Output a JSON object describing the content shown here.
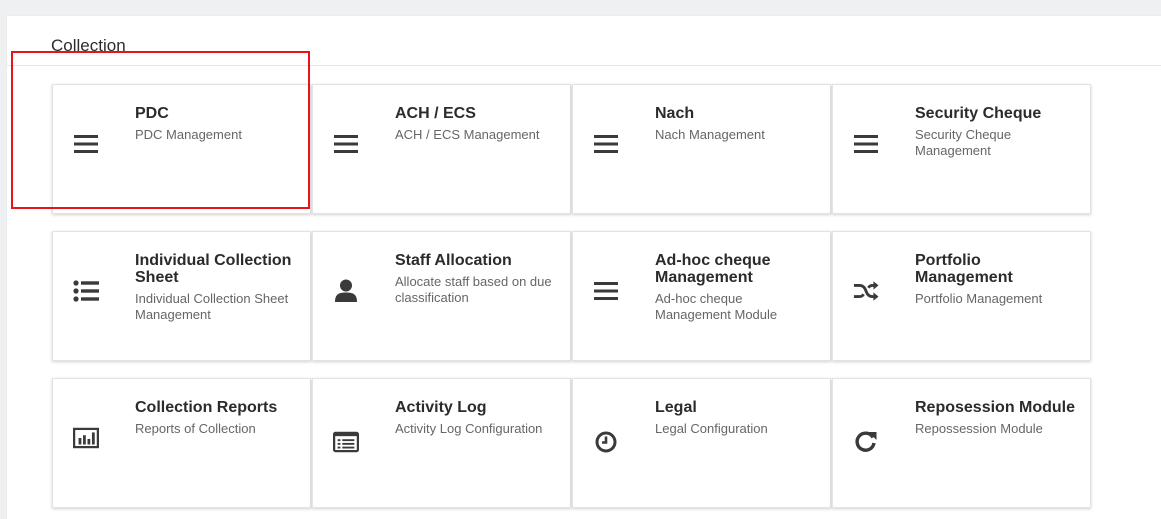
{
  "section": {
    "title": "Collection"
  },
  "colors": {
    "highlight": "#e8141c",
    "icon": "#3a3a3a"
  },
  "cards": [
    {
      "title": "PDC",
      "description": "PDC Management",
      "icon": "menu-icon"
    },
    {
      "title": "ACH / ECS",
      "description": "ACH / ECS Management",
      "icon": "menu-icon"
    },
    {
      "title": "Nach",
      "description": "Nach Management",
      "icon": "menu-icon"
    },
    {
      "title": "Security Cheque",
      "description": "Security Cheque Management",
      "icon": "menu-icon"
    },
    {
      "title": "Individual Collection Sheet",
      "description": "Individual Collection Sheet Management",
      "icon": "list-icon"
    },
    {
      "title": "Staff Allocation",
      "description": "Allocate staff based on due classification",
      "icon": "user-icon"
    },
    {
      "title": "Ad-hoc cheque Management",
      "description": "Ad-hoc cheque Management Module",
      "icon": "menu-icon"
    },
    {
      "title": "Portfolio Management",
      "description": "Portfolio Management",
      "icon": "shuffle-icon"
    },
    {
      "title": "Collection Reports",
      "description": "Reports of Collection",
      "icon": "bar-chart-icon"
    },
    {
      "title": "Activity Log",
      "description": "Activity Log Configuration",
      "icon": "list-alt-icon"
    },
    {
      "title": "Legal",
      "description": "Legal Configuration",
      "icon": "clock-icon"
    },
    {
      "title": "Reposession Module",
      "description": "Repossession Module",
      "icon": "refresh-icon"
    }
  ]
}
